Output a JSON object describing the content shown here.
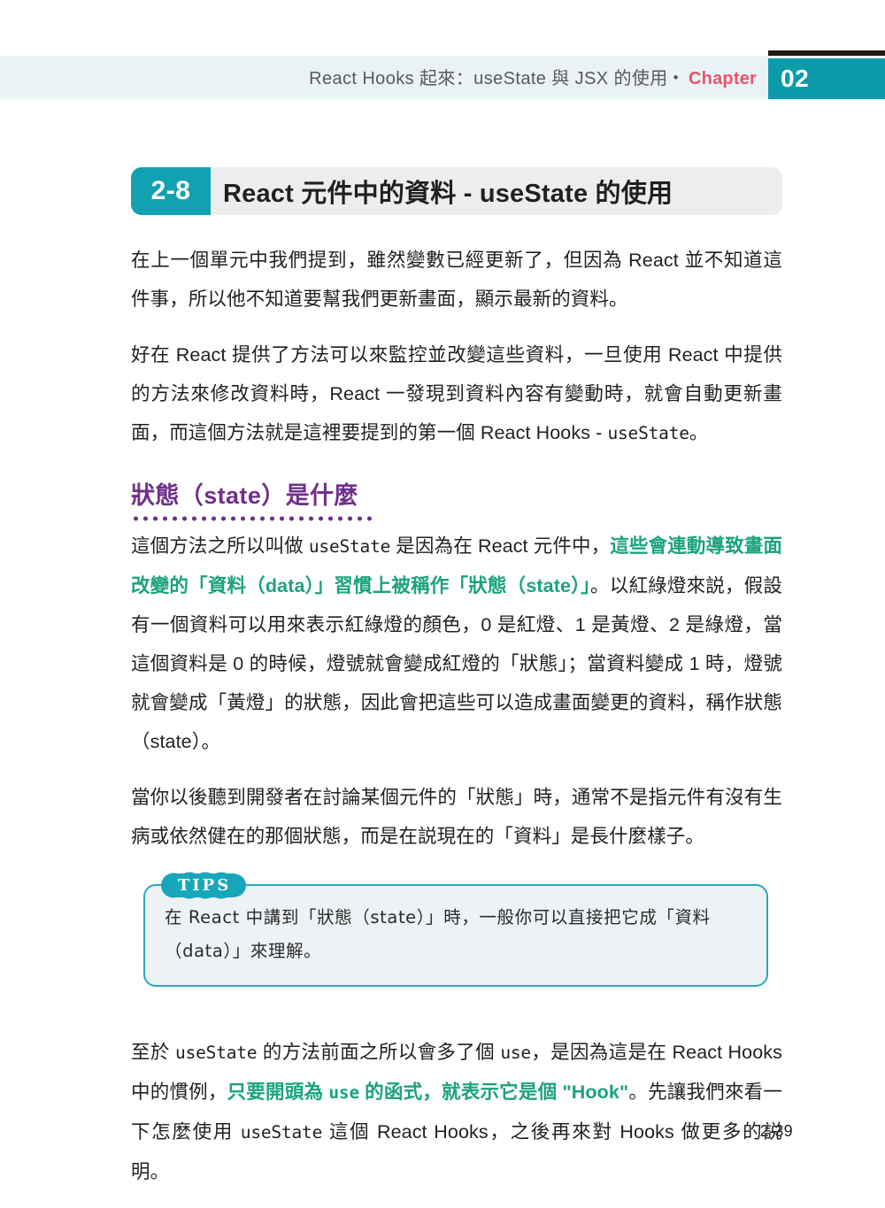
{
  "header": {
    "running_title": "React Hooks 起來：useState 與 JSX 的使用",
    "separator": "•",
    "chapter_word": "Chapter",
    "chapter_number": "02",
    "accent_color": "#0c9bab",
    "chapter_word_color": "#e8556d",
    "band_color": "#eaf2f5"
  },
  "section": {
    "number": "2-8",
    "title": "React 元件中的資料 - useState 的使用",
    "chip_color": "#12a1b0",
    "bar_color": "#eceded"
  },
  "body": {
    "paragraph_1": "在上一個單元中我們提到，雖然變數已經更新了，但因為 React 並不知道這件事，所以他不知道要幫我們更新畫面，顯示最新的資料。",
    "paragraph_2_part1": "好在 React 提供了方法可以來監控並改變這些資料，一旦使用 React 中提供的方法來修改資料時，React 一發現到資料內容有變動時，就會自動更新畫面，而這個方法就是這裡要提到的第一個 React Hooks - ",
    "paragraph_2_code": "useState",
    "paragraph_2_part2": "。",
    "subheading": "狀態（state）是什麼",
    "subheading_color": "#70308c",
    "paragraph_3_part1": "這個方法之所以叫做 ",
    "paragraph_3_code1": "useState",
    "paragraph_3_part2": " 是因為在 React 元件中，",
    "paragraph_3_highlight": "這些會連動導致畫面改變的「資料（data）」習慣上被稱作「狀態（state）」",
    "paragraph_3_part3": "。以紅綠燈來説，假設有一個資料可以用來表示紅綠燈的顏色，0 是紅燈、1 是黃燈、2 是綠燈，當這個資料是 0 的時候，燈號就會變成紅燈的「狀態」；當資料變成 1 時，燈號就會變成「黃燈」的狀態，因此會把這些可以造成畫面變更的資料，稱作狀態（state）。",
    "paragraph_4": "當你以後聽到開發者在討論某個元件的「狀態」時，通常不是指元件有沒有生病或依然健在的那個狀態，而是在説現在的「資料」是長什麼樣子。",
    "paragraph_5_part1": "至於 ",
    "paragraph_5_code1": "useState",
    "paragraph_5_part2": " 的方法前面之所以會多了個 ",
    "paragraph_5_code2": "use",
    "paragraph_5_part3": "，是因為這是在 React Hooks 中的慣例，",
    "paragraph_5_highlight_a": "只要開頭為 ",
    "paragraph_5_highlight_code": "use",
    "paragraph_5_highlight_b": " 的函式，就表示它是個 \"Hook\"",
    "paragraph_5_part4": "。先讓我們來看一下怎麼使用 ",
    "paragraph_5_code3": "useState",
    "paragraph_5_part5": " 這個 React Hooks，之後再來對 Hooks 做更多的説明。",
    "highlight_color": "#1aa37e"
  },
  "tips": {
    "badge_letters": [
      "T",
      "I",
      "P",
      "S"
    ],
    "badge_label": "TIPS",
    "text": "在 React 中講到「狀態（state）」時，一般你可以直接把它成「資料（data）」來理解。",
    "border_color": "#2aa9bd",
    "fill_color": "#eef2f5"
  },
  "footer": {
    "page_number": "2-39"
  }
}
